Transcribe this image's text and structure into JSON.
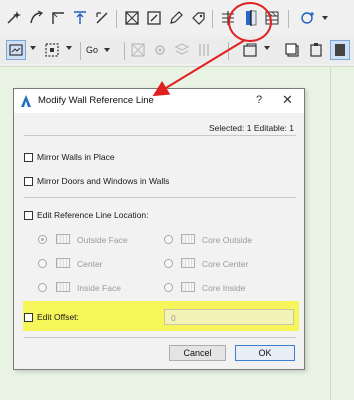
{
  "toolbar": {
    "row1_icons": [
      "magic-wand-icon",
      "pick-up-icon",
      "corner-icon",
      "align-icon",
      "hotlink-icon",
      "grid-cell-icon",
      "edit-selection-icon",
      "pencil-icon",
      "tag-icon",
      "wall-offset-icon",
      "modify-reference-line-icon",
      "wall-layers-icon",
      "add-object-icon"
    ],
    "row2_icons": [
      "view-mode-icon",
      "marquee-icon",
      "render-icon",
      "go-icon",
      "settings-icon",
      "layers-icon",
      "library-icon",
      "box-icon"
    ],
    "go_label": "Go"
  },
  "annotation": {
    "color": "#e02020"
  },
  "dialog": {
    "title": "Modify Wall Reference Line",
    "help": "?",
    "close": "✕",
    "selected_info": "Selected: 1 Editable: 1",
    "options": {
      "mirror_walls": "Mirror Walls in Place",
      "mirror_doors": "Mirror Doors and Windows in Walls",
      "edit_location": "Edit Reference Line Location:"
    },
    "location_left": [
      "Outside Face",
      "Center",
      "Inside Face"
    ],
    "location_right": [
      "Core Outside",
      "Core Center",
      "Core Inside"
    ],
    "edit_offset_label": "Edit Offset:",
    "edit_offset_value": "0",
    "cancel_label": "Cancel",
    "ok_label": "OK"
  },
  "colors": {
    "highlight": "#f6f65a",
    "background": "#e8f3e4",
    "ok_border": "#3c7fd1"
  }
}
